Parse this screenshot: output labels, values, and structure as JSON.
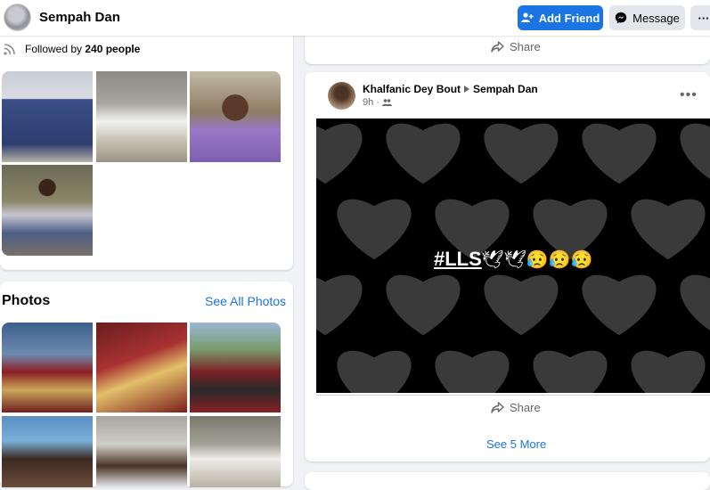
{
  "header": {
    "profile_name": "Sempah Dan",
    "add_friend_label": "Add Friend",
    "message_label": "Message",
    "more_label": "···"
  },
  "intro": {
    "followed_prefix": "Followed by",
    "followed_count": "240 people"
  },
  "photos_section": {
    "title": "Photos",
    "see_all_label": "See All Photos"
  },
  "feed": {
    "share_label": "Share",
    "post": {
      "author": "Khalfanic Dey Bout",
      "target": "Sempah Dan",
      "time": "9h",
      "hashtag": "#LLS",
      "emojis": "🕊🕊😥😥😥",
      "share_label": "Share"
    },
    "see_more_label": "See 5 More"
  },
  "colors": {
    "accent": "#1b74e4",
    "secondary_button": "#e4e6eb",
    "background": "#f0f2f5"
  }
}
